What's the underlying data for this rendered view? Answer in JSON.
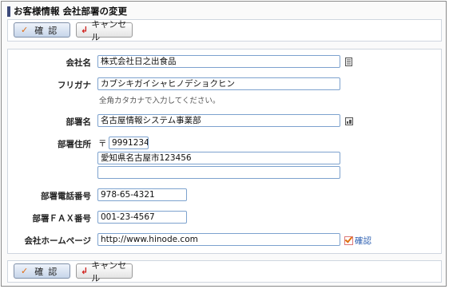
{
  "page": {
    "title": "お客様情報 会社部署の変更"
  },
  "buttons": {
    "confirm_icon": "✓",
    "confirm_label": "確認",
    "cancel_icon": "↲",
    "cancel_label": "キャンセル"
  },
  "form": {
    "company_name": {
      "label": "会社名",
      "value": "株式会社日之出食品"
    },
    "furigana": {
      "label": "フリガナ",
      "value": "カブシキガイシャヒノデショクヒン",
      "hint": "全角カタカナで入力してください。"
    },
    "department": {
      "label": "部署名",
      "value": "名古屋情報システム事業部"
    },
    "address": {
      "label": "部署住所",
      "zip_mark": "〒",
      "zip": "9991234",
      "line1": "愛知県名古屋市123456",
      "line2": ""
    },
    "phone": {
      "label": "部署電話番号",
      "value": "978-65-4321"
    },
    "fax": {
      "label": "部署ＦＡＸ番号",
      "value": "001-23-4567"
    },
    "homepage": {
      "label": "会社ホームページ",
      "value": "http://www.hinode.com",
      "check_label": "確認"
    }
  },
  "colors": {
    "title_mark": "#3d4a7a",
    "input_border": "#7da2ce",
    "link": "#2a5db0"
  }
}
